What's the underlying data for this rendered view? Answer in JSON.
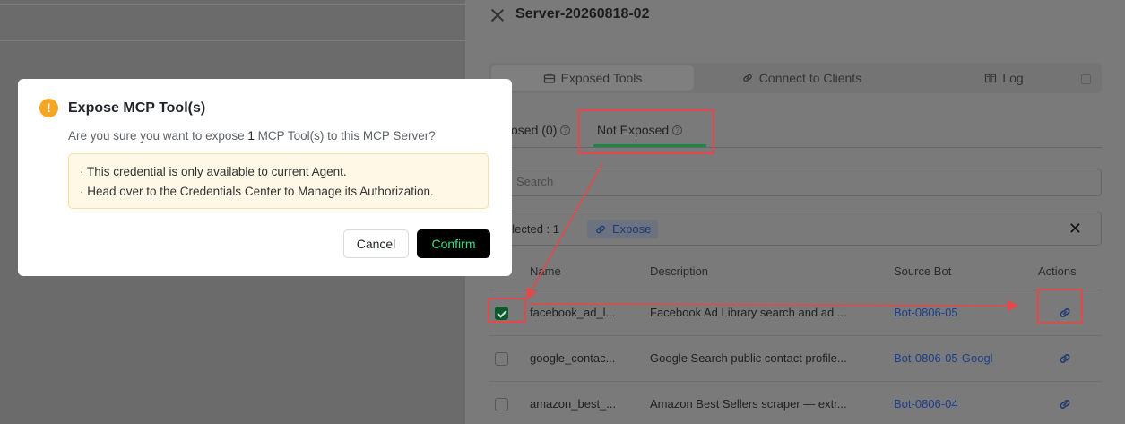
{
  "drawer": {
    "title": "Server-20260818-02",
    "tabs": [
      {
        "label": "Exposed Tools",
        "icon": "toolbox-icon"
      },
      {
        "label": "Connect to Clients",
        "icon": "link-icon"
      },
      {
        "label": "Log",
        "icon": "book-icon"
      }
    ],
    "subtabs": {
      "exposed_label": "osed (0)",
      "not_exposed_label": "Not Exposed"
    },
    "search": {
      "placeholder": "Search"
    },
    "selection": {
      "label": "elected : 1",
      "expose_label": "Expose",
      "close_glyph": "✕"
    },
    "table": {
      "headers": [
        "Name",
        "Description",
        "Source Bot",
        "Actions"
      ],
      "rows": [
        {
          "name": "facebook_ad_l...",
          "description": "Facebook Ad Library search and ad ...",
          "bot": "Bot-0806-05",
          "checked": true
        },
        {
          "name": "google_contac...",
          "description": "Google Search public contact profile...",
          "bot": "Bot-0806-05-Googl",
          "checked": false
        },
        {
          "name": "amazon_best_...",
          "description": "Amazon Best Sellers scraper — extr...",
          "bot": "Bot-0806-04",
          "checked": false
        }
      ]
    }
  },
  "modal": {
    "icon_glyph": "!",
    "title": "Expose MCP Tool(s)",
    "desc_prefix": "Are you sure you want to expose ",
    "desc_count": "1",
    "desc_suffix": " MCP Tool(s) to this MCP Server?",
    "notice_lines": [
      "· This credential is only available to current Agent.",
      "· Head over to the Credentials Center to Manage its Authorization."
    ],
    "cancel_label": "Cancel",
    "confirm_label": "Confirm"
  },
  "colors": {
    "warning": "#f5a623",
    "confirm_text": "#38e07b",
    "annotation": "#e6484a",
    "active_underline": "#178a4a"
  }
}
